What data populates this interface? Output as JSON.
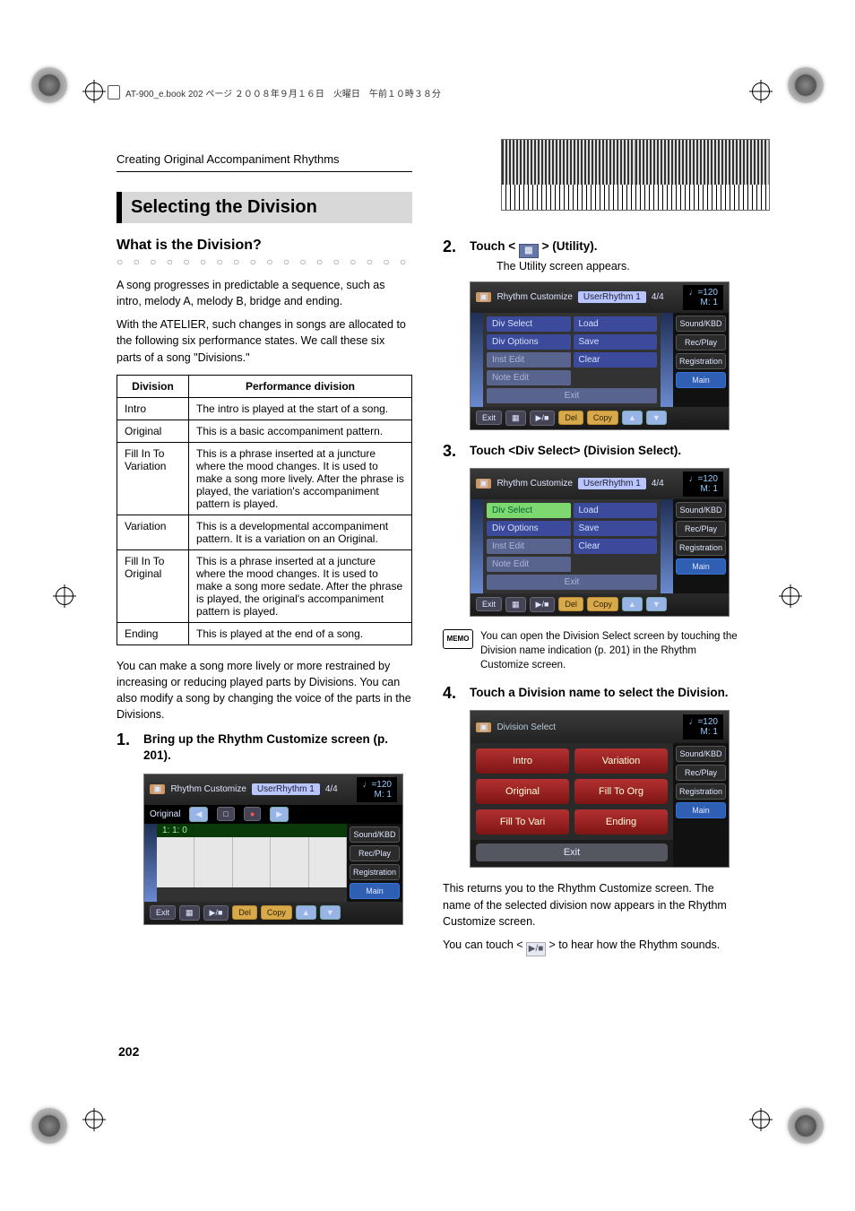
{
  "header_strip": "AT-900_e.book  202 ページ  ２００８年９月１６日　火曜日　午前１０時３８分",
  "breadcrumb": "Creating Original Accompaniment Rhythms",
  "section_title": "Selecting the Division",
  "subhead": "What is the Division?",
  "intro_para_1": "A song progresses in predictable a sequence, such as intro, melody A, melody B, bridge and ending.",
  "intro_para_2": "With the ATELIER, such changes in songs are allocated to the following six performance states. We call these six parts of a song \"Divisions.\"",
  "table": {
    "head": [
      "Division",
      "Performance division"
    ],
    "rows": [
      [
        "Intro",
        "The intro is played at the start of a song."
      ],
      [
        "Original",
        "This is a basic accompaniment pattern."
      ],
      [
        "Fill In To Variation",
        "This is a phrase inserted at a juncture where the mood changes.\nIt is used to make a song more lively.\nAfter the phrase is played, the variation's accompaniment pattern is played."
      ],
      [
        "Variation",
        "This is a developmental accompaniment pattern. It is a variation on an Original."
      ],
      [
        "Fill In To Original",
        "This is a phrase inserted at a juncture where the mood changes.\nIt is used to make a song more sedate.\nAfter the phrase is played, the original's accompaniment pattern is played."
      ],
      [
        "Ending",
        "This is played at the end of a song."
      ]
    ]
  },
  "after_table": "You can make a song more lively or more restrained by increasing or reducing played parts by Divisions. You can also modify a song by changing the voice of the parts in the Divisions.",
  "steps": {
    "s1": "Bring up the Rhythm Customize screen (p. 201).",
    "s2": "Touch <          > (Utility).",
    "s2_icon_name": "utility-icon",
    "s2_note": "The Utility screen appears.",
    "s3": "Touch <Div Select> (Division Select).",
    "s4": "Touch a Division name to select the Division."
  },
  "memo": "You can open the Division Select screen by touching the Division name indication (p. 201) in the Rhythm Customize screen.",
  "closing_1": "This returns you to the Rhythm Customize screen. The name of the selected division now appears in the Rhythm Customize screen.",
  "closing_2_a": "You can touch < ",
  "closing_2_b": " > to hear how the Rhythm sounds.",
  "page_number": "202",
  "lcd_common": {
    "tempo": "♩=120",
    "measure": "M:   1",
    "side": [
      "Sound/KBD",
      "Rec/Play",
      "Registration",
      "Main"
    ],
    "exit": "Exit",
    "del": "Del",
    "copy": "Copy",
    "play": "▶/■"
  },
  "lcd1": {
    "title": "Rhythm Customize",
    "badge": "UserRhythm 1",
    "ts": "4/4",
    "origin_label": "Original",
    "counter": "1: 1:  0"
  },
  "lcd2": {
    "title": "Rhythm Customize",
    "badge": "UserRhythm 1",
    "ts": "4/4",
    "left": [
      "Div Select",
      "Div Options",
      "Inst Edit",
      "Note Edit"
    ],
    "right": [
      "Load",
      "Save",
      "Clear"
    ]
  },
  "lcd3": {
    "title": "Division Select",
    "buttons": [
      "Intro",
      "Variation",
      "Original",
      "Fill To Org",
      "Fill To Vari",
      "Ending"
    ]
  }
}
